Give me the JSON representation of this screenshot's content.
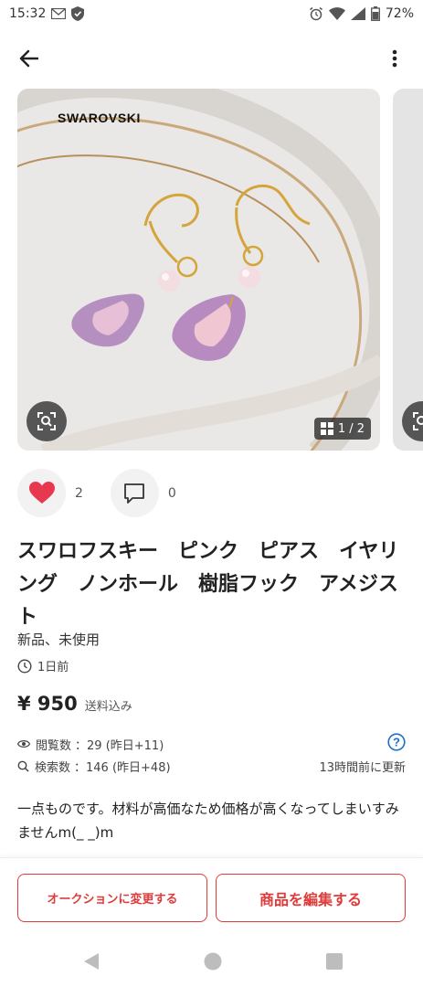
{
  "status_bar": {
    "time": "15:32",
    "battery": "72%"
  },
  "gallery": {
    "brand_text": "SWAROVSKI",
    "counter": "1 / 2"
  },
  "actions": {
    "likes": "2",
    "comments": "0"
  },
  "item": {
    "title": "スワロフスキー　ピンク　ピアス　イヤリング　ノンホール　樹脂フック　アメジスト",
    "condition": "新品、未使用",
    "posted": "1日前",
    "price": "¥ 950",
    "shipping": "送料込み"
  },
  "stats": {
    "views_label": "閲覧数",
    "views_value": "：29 (昨日+11)",
    "searches_label": "検索数",
    "searches_value": "：146 (昨日+48)",
    "updated": "13時間前に更新"
  },
  "description": "一点ものです。材料が高価なため価格が高くなってしまいすみませんm(_ _)m",
  "bottom_bar": {
    "auction_label": "オークションに変更する",
    "edit_label": "商品を編集する"
  },
  "colors": {
    "accent": "#e03b3b",
    "heart": "#e8384f",
    "help": "#1a6fc9"
  }
}
